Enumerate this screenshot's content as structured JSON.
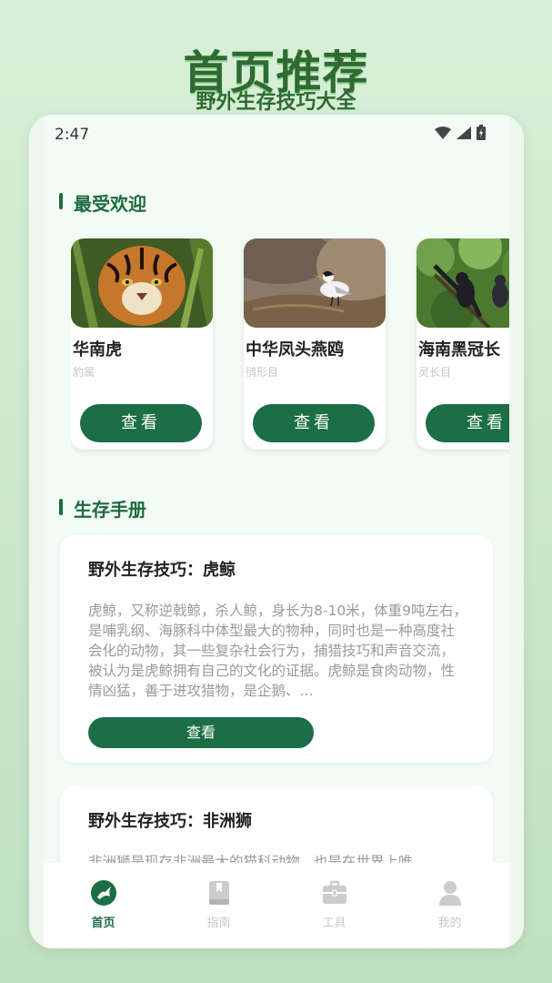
{
  "promo": {
    "title": "首页推荐",
    "subtitle": "野外生存技巧大全"
  },
  "status_bar": {
    "time": "2:47"
  },
  "sections": {
    "popular": "最受欢迎",
    "handbook": "生存手册"
  },
  "animals": [
    {
      "name": "华南虎",
      "tag": "豹属",
      "button": "查看"
    },
    {
      "name": "中华凤头燕鸥",
      "tag": "鸻形目",
      "button": "查看"
    },
    {
      "name": "海南黑冠长",
      "tag": "灵长目",
      "button": "查看"
    }
  ],
  "guides": [
    {
      "title": "野外生存技巧：虎鲸",
      "body": "虎鲸，又称逆戟鲸，杀人鲸，身长为8-10米，体重9吨左右，是哺乳纲、海豚科中体型最大的物种，同时也是一种高度社会化的动物，其一些复杂社会行为，捕猎技巧和声音交流，被认为是虎鲸拥有自己的文化的证据。虎鲸是食肉动物，性情凶猛，善于进攻猎物，是企鹅、...",
      "button": "查看"
    },
    {
      "title": "野外生存技巧：非洲狮",
      "body": "非洲狮是现存非洲最大的猫科动物，也是在世界上唯"
    }
  ],
  "tabbar": [
    {
      "label": "首页",
      "icon": "home-icon",
      "active": true
    },
    {
      "label": "指南",
      "icon": "book-icon",
      "active": false
    },
    {
      "label": "工具",
      "icon": "toolbox-icon",
      "active": false
    },
    {
      "label": "我的",
      "icon": "user-icon",
      "active": false
    }
  ],
  "colors": {
    "accent": "#1b6e45",
    "promo_text": "#2e6b2f",
    "screen_bg": "#f2fbf5"
  }
}
